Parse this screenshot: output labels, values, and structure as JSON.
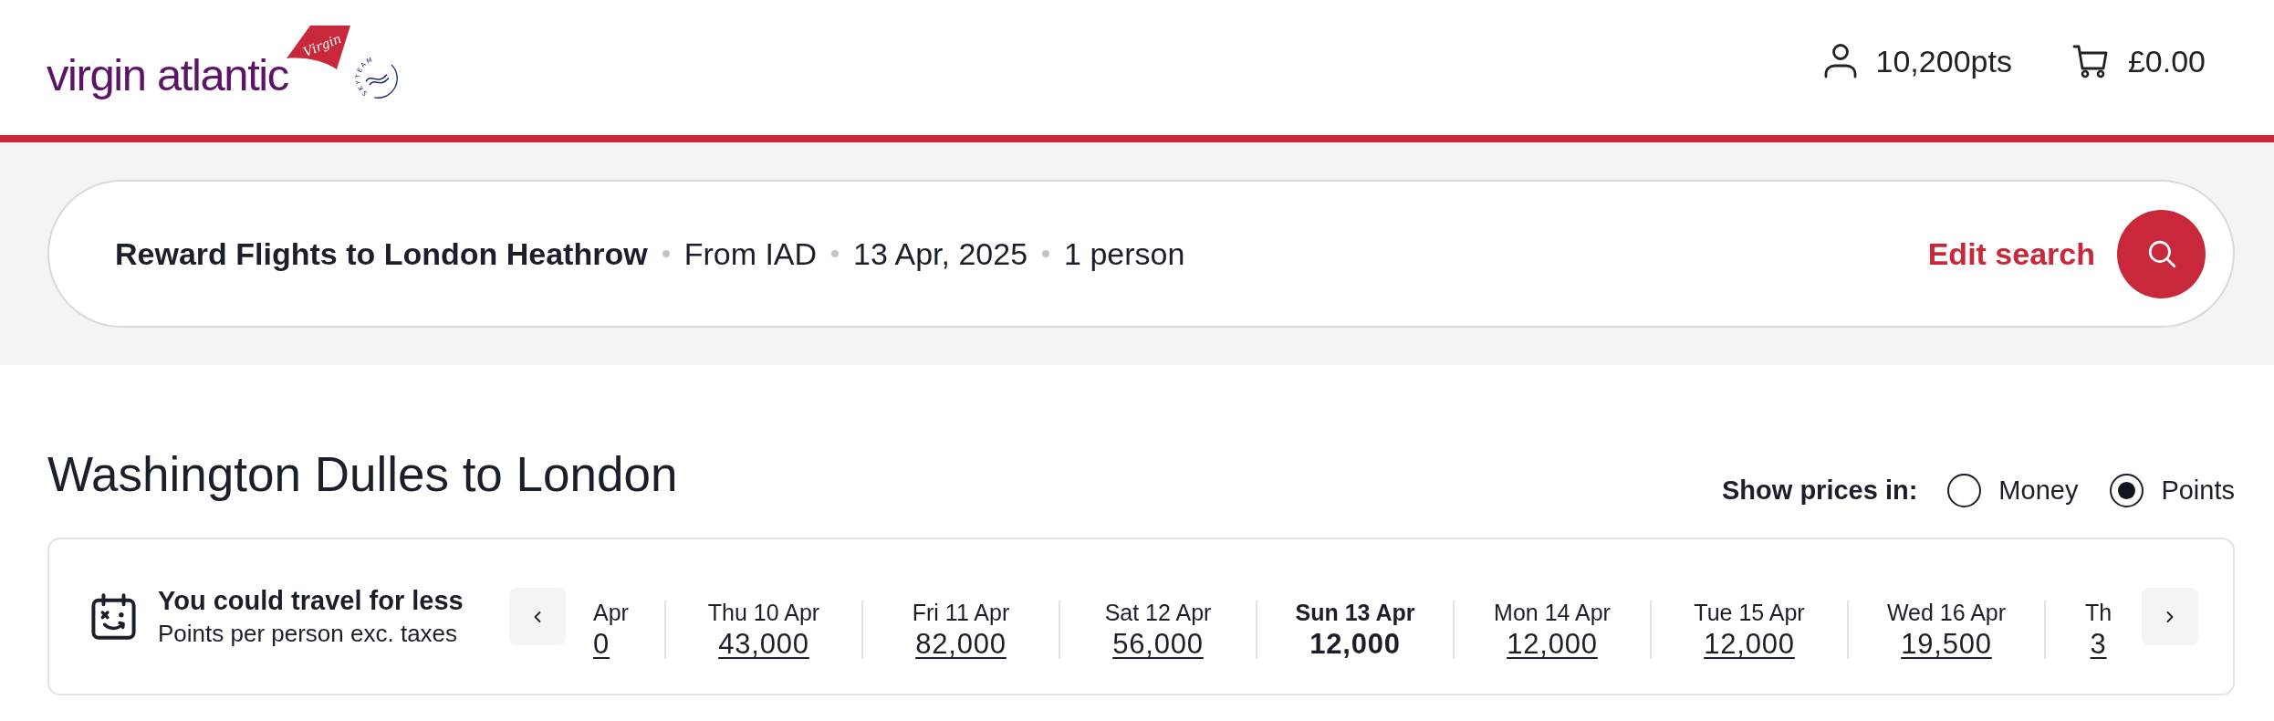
{
  "header": {
    "logo": {
      "wordmark": "virgin atlantic",
      "tail_text": "Virgin",
      "alliance_text": "SKYTEAM"
    },
    "points": "10,200pts",
    "basket_total": "£0.00"
  },
  "search_summary": {
    "title": "Reward Flights to London Heathrow",
    "details": [
      "From IAD",
      "13 Apr, 2025",
      "1 person"
    ],
    "edit_label": "Edit search"
  },
  "route_heading": "Washington Dulles to London",
  "price_toggle": {
    "label": "Show prices in:",
    "options": [
      {
        "label": "Money",
        "selected": false
      },
      {
        "label": "Points",
        "selected": true
      }
    ]
  },
  "date_strip": {
    "title": "You could travel for less",
    "subtitle": "Points per person exc. taxes",
    "dates": [
      {
        "day": "Apr",
        "price": "0",
        "selected": false
      },
      {
        "day": "Thu 10 Apr",
        "price": "43,000",
        "selected": false
      },
      {
        "day": "Fri 11 Apr",
        "price": "82,000",
        "selected": false
      },
      {
        "day": "Sat 12 Apr",
        "price": "56,000",
        "selected": false
      },
      {
        "day": "Sun 13 Apr",
        "price": "12,000",
        "selected": true
      },
      {
        "day": "Mon 14 Apr",
        "price": "12,000",
        "selected": false
      },
      {
        "day": "Tue 15 Apr",
        "price": "12,000",
        "selected": false
      },
      {
        "day": "Wed 16 Apr",
        "price": "19,500",
        "selected": false
      },
      {
        "day": "Th",
        "price": "3",
        "selected": false
      }
    ]
  }
}
